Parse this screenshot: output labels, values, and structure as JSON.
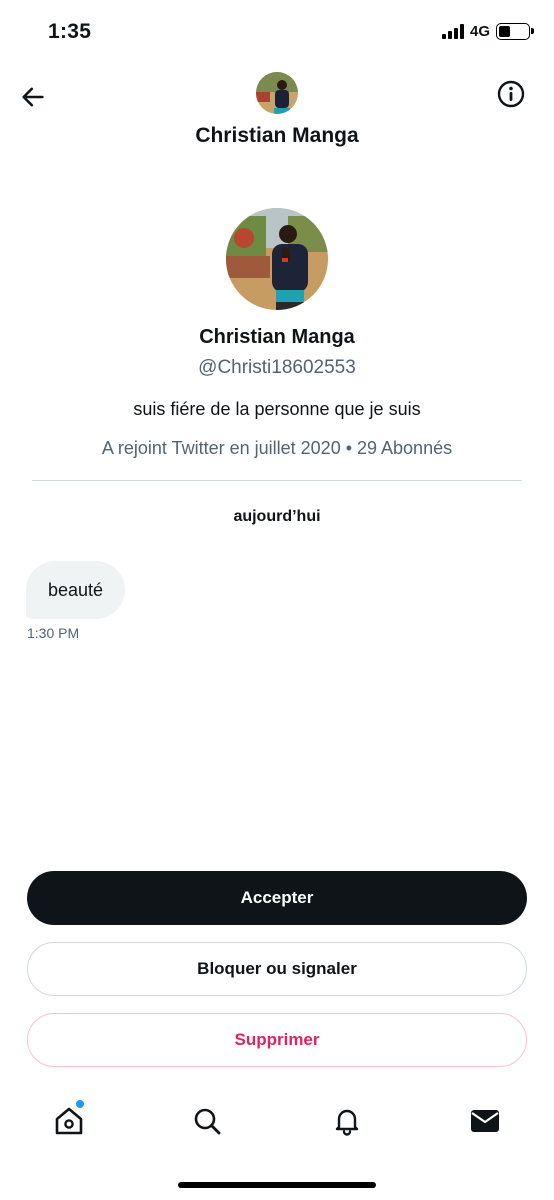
{
  "status_bar": {
    "time": "1:35",
    "network": "4G",
    "battery_level": 0.4
  },
  "header": {
    "title": "Christian Manga",
    "back_icon": "arrow-left-icon",
    "info_icon": "info-icon"
  },
  "profile": {
    "name": "Christian Manga",
    "handle": "@Christi18602553",
    "bio": "suis fiére de la personne que je suis",
    "meta": "A rejoint Twitter en juillet 2020 • 29 Abonnés"
  },
  "conversation": {
    "date_separator": "aujourd’hui",
    "messages": [
      {
        "text": "beauté",
        "time": "1:30 PM"
      }
    ]
  },
  "actions": {
    "accept_label": "Accepter",
    "block_label": "Bloquer ou signaler",
    "delete_label": "Supprimer"
  },
  "tabbar": {
    "items": [
      "home-icon",
      "search-icon",
      "bell-icon",
      "mail-icon"
    ],
    "home_has_notification": true
  },
  "colors": {
    "accent": "#1d9bf0",
    "danger": "#e0245e",
    "primary_button": "#0f1419",
    "secondary_text": "#536471"
  }
}
